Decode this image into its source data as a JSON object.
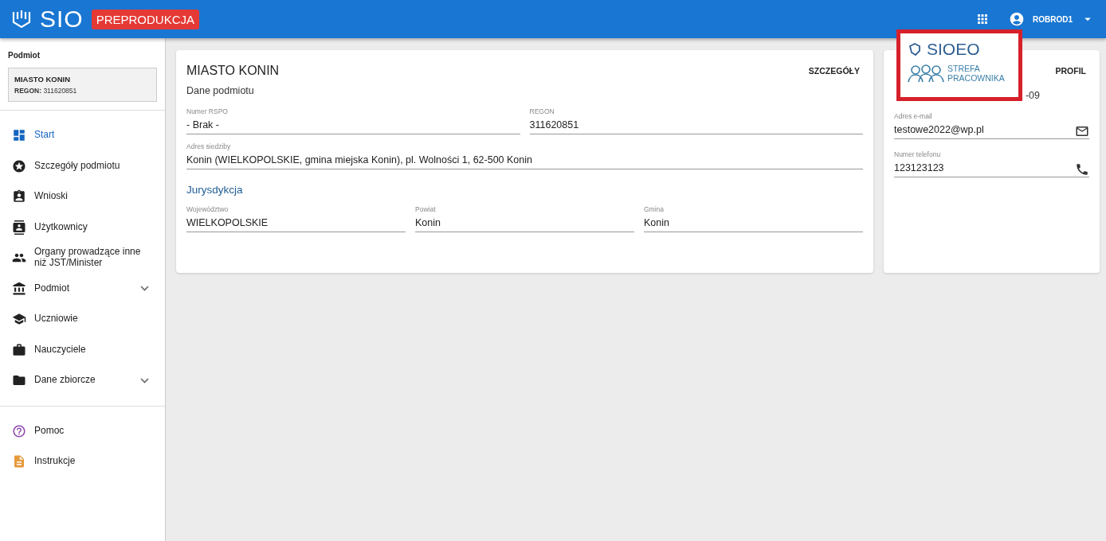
{
  "header": {
    "logo": "SIO",
    "env_badge": "PREPRODUKCJA",
    "user": "ROBROD1"
  },
  "sidebar": {
    "section_label": "Podmiot",
    "entity": {
      "name": "MIASTO KONIN",
      "regon_label": "REGON:",
      "regon": "311620851"
    },
    "items": [
      {
        "label": "Start",
        "selected": true
      },
      {
        "label": "Szczegóły podmiotu",
        "selected": false
      },
      {
        "label": "Wnioski",
        "selected": false
      },
      {
        "label": "Użytkownicy",
        "selected": false
      },
      {
        "label": "Organy prowadzące inne niż JST/Minister",
        "selected": false
      },
      {
        "label": "Podmiot",
        "selected": false,
        "expanded": false
      },
      {
        "label": "Uczniowie",
        "selected": false
      },
      {
        "label": "Nauczyciele",
        "selected": false
      },
      {
        "label": "Dane zbiorcze",
        "selected": false,
        "expanded": false
      }
    ],
    "footer_items": [
      {
        "label": "Pomoc",
        "color": "#8e44ad"
      },
      {
        "label": "Instrukcje",
        "color": "#e69a3c"
      }
    ]
  },
  "details_card": {
    "title": "MIASTO KONIN",
    "action": "SZCZEGÓŁY",
    "subtitle": "Dane podmiotu",
    "rows": [
      [
        {
          "label": "Numer RSPO",
          "value": "- Brak -"
        },
        {
          "label": "REGON",
          "value": "311620851"
        }
      ],
      [
        {
          "label": "Adres siedziby",
          "value": "Konin (WIELKOPOLSKIE, gmina miejska Konin), pl. Wolności 1, 62-500 Konin"
        }
      ]
    ],
    "section": "Jurysdykcja",
    "jurisdiction": [
      {
        "label": "Województwo",
        "value": "WIELKOPOLSKIE"
      },
      {
        "label": "Powiat",
        "value": "Konin"
      },
      {
        "label": "Gmina",
        "value": "Konin"
      }
    ]
  },
  "profile_card": {
    "action": "PROFIL",
    "partial_line": "-09",
    "fields": [
      {
        "kind": "email",
        "label": "Adres e-mail",
        "value": "testowe2022@wp.pl"
      },
      {
        "kind": "phone",
        "label": "Numer telefonu",
        "value": "123123123"
      }
    ]
  },
  "popup": {
    "title": "SIOEO",
    "subtitle_line_1": "STREFA",
    "subtitle_line_2": "PRACOWNIKA"
  }
}
